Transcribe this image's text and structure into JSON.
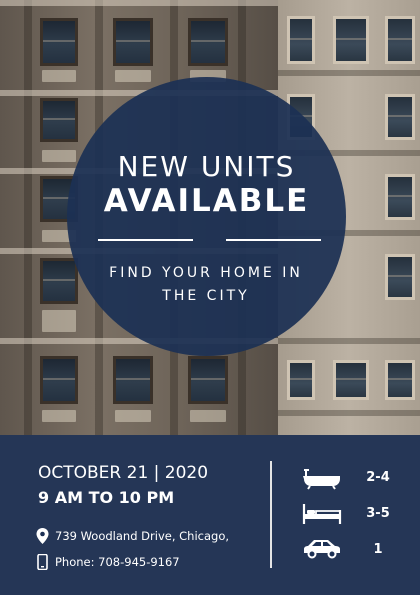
{
  "headline": {
    "line1": "NEW UNITS",
    "line2": "AVAILABLE",
    "tagline": "FIND YOUR HOME IN THE CITY"
  },
  "event": {
    "date": "OCTOBER 21 | 2020",
    "time": "9 AM TO 10 PM"
  },
  "contact": {
    "address": "739 Woodland Drive, Chicago,",
    "address_icon": "location-pin-icon",
    "phone": "Phone: 708-945-9167",
    "phone_icon": "mobile-phone-icon"
  },
  "features": [
    {
      "icon": "bathtub-icon",
      "value": "2-4"
    },
    {
      "icon": "bed-icon",
      "value": "3-5"
    },
    {
      "icon": "car-icon",
      "value": "1"
    }
  ],
  "colors": {
    "navy_overlay": "#1c3054",
    "text": "#ffffff"
  }
}
